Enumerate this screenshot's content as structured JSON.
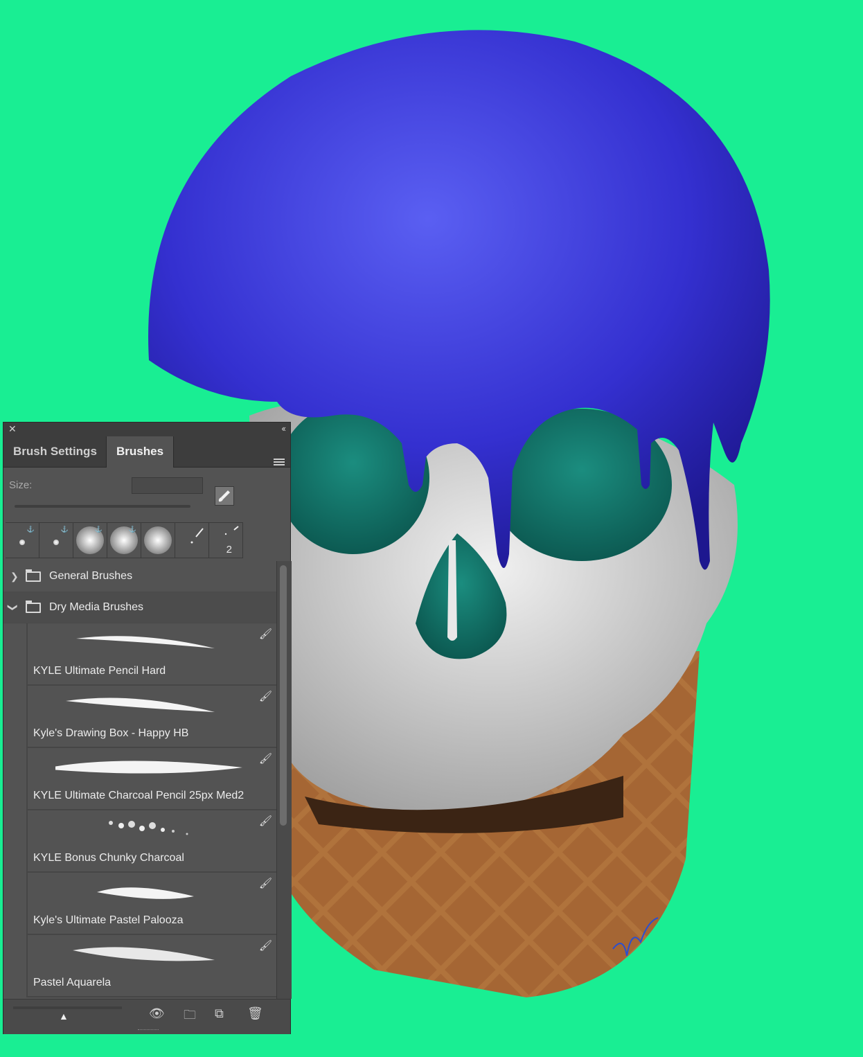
{
  "panel": {
    "tabs": [
      {
        "label": "Brush Settings",
        "active": false
      },
      {
        "label": "Brushes",
        "active": true
      }
    ],
    "size_label": "Size:",
    "presets": [
      {
        "kind": "hard-small",
        "badge": "⚓"
      },
      {
        "kind": "hard-small",
        "badge": "⚓"
      },
      {
        "kind": "soft-large",
        "badge": "⚓"
      },
      {
        "kind": "soft-large",
        "badge": "⚓"
      },
      {
        "kind": "soft-large",
        "badge": ""
      },
      {
        "kind": "brush-tip",
        "badge": ""
      },
      {
        "kind": "brush-tip",
        "badge": "",
        "number": "2"
      }
    ],
    "groups": [
      {
        "label": "General Brushes",
        "expanded": false
      },
      {
        "label": "Dry Media Brushes",
        "expanded": true
      }
    ],
    "brushes": [
      {
        "label": "KYLE Ultimate Pencil Hard"
      },
      {
        "label": "Kyle's Drawing Box - Happy HB"
      },
      {
        "label": "KYLE Ultimate Charcoal Pencil 25px Med2"
      },
      {
        "label": "KYLE Bonus Chunky Charcoal"
      },
      {
        "label": "Kyle's Ultimate Pastel Palooza"
      },
      {
        "label": "Pastel Aquarela"
      }
    ]
  },
  "colors": {
    "background": "#19ee93",
    "ice_cream": "#3a35d6",
    "cone": "#b97a43",
    "skull": "#d8d8d8",
    "eye": "#157a6e",
    "panel": "#535353"
  }
}
